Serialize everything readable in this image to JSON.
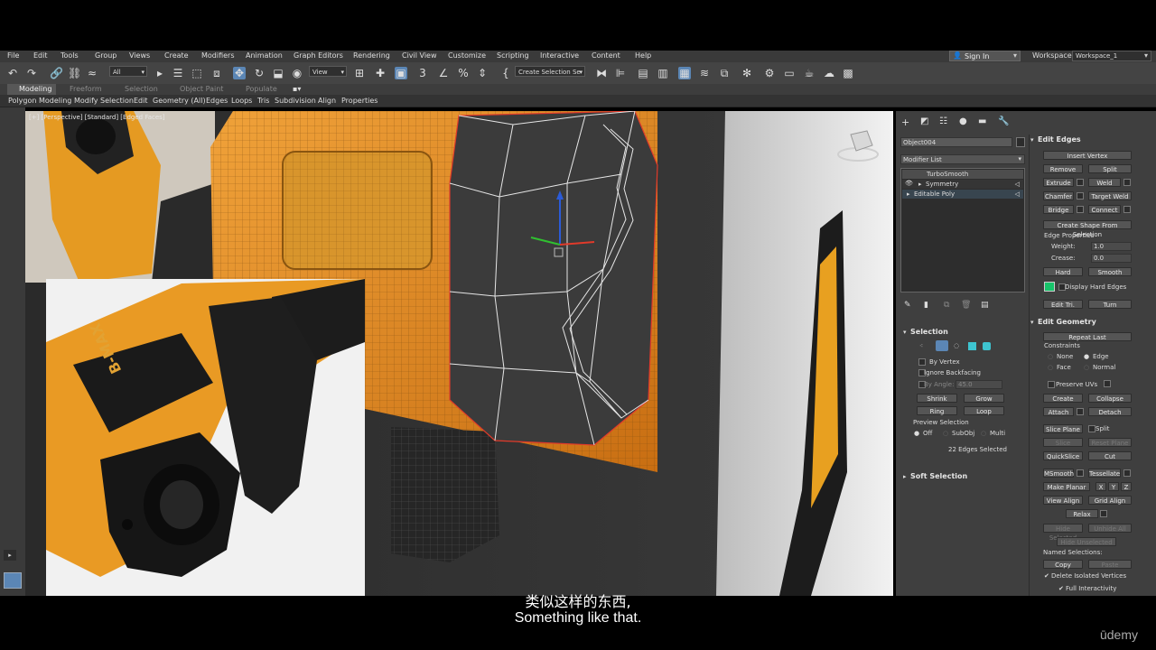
{
  "menu": [
    "File",
    "Edit",
    "Tools",
    "Group",
    "Views",
    "Create",
    "Modifiers",
    "Animation",
    "Graph Editors",
    "Rendering",
    "Civil View",
    "Customize",
    "Scripting",
    "Interactive",
    "Content",
    "Help"
  ],
  "account": {
    "sign_in": "Sign In",
    "workspaces_label": "Workspaces:",
    "workspace_value": "Workspace_1"
  },
  "toolbar": {
    "filter_value": "All",
    "view_value": "View",
    "create_selection_set": "Create Selection Se"
  },
  "ribbon_tabs": [
    "Modeling",
    "Freeform",
    "Selection",
    "Object Paint",
    "Populate"
  ],
  "subribbon": [
    "Polygon Modeling",
    "Modify Selection",
    "Edit",
    "Geometry (All)",
    "Edges",
    "Loops",
    "Tris",
    "Subdivision",
    "Align",
    "Properties"
  ],
  "viewport": {
    "label": "[+] [Perspective] [Standard] [Edged Faces]",
    "product_brand": "B-MAX"
  },
  "command_panel": {
    "object_name": "Object004",
    "modifier_list": "Modifier List",
    "stack": [
      "TurboSmooth",
      "Symmetry",
      "Editable Poly"
    ],
    "selection": {
      "title": "Selection",
      "by_vertex": "By Vertex",
      "ignore_backfacing": "Ignore Backfacing",
      "by_angle": "By Angle:",
      "angle_value": "45.0",
      "shrink": "Shrink",
      "grow": "Grow",
      "ring": "Ring",
      "loop": "Loop",
      "preview_selection": "Preview Selection",
      "off": "Off",
      "subobj": "SubObj",
      "multi": "Multi",
      "status": "22 Edges Selected"
    },
    "soft_selection": "Soft Selection",
    "edit_edges": {
      "title": "Edit Edges",
      "insert_vertex": "Insert Vertex",
      "remove": "Remove",
      "split": "Split",
      "extrude": "Extrude",
      "weld": "Weld",
      "chamfer": "Chamfer",
      "target_weld": "Target Weld",
      "bridge": "Bridge",
      "connect": "Connect",
      "create_shape": "Create Shape From Selection",
      "edge_properties": "Edge Properties",
      "weight_label": "Weight:",
      "weight_value": "1.0",
      "crease_label": "Crease:",
      "crease_value": "0.0",
      "hard": "Hard",
      "smooth": "Smooth",
      "display_hard_edges": "Display Hard Edges",
      "edit_tri": "Edit Tri.",
      "turn": "Turn"
    },
    "edit_geometry": {
      "title": "Edit Geometry",
      "repeat_last": "Repeat Last",
      "constraints": "Constraints",
      "none": "None",
      "edge": "Edge",
      "face": "Face",
      "normal": "Normal",
      "preserve_uvs": "Preserve UVs",
      "create": "Create",
      "collapse": "Collapse",
      "attach": "Attach",
      "detach": "Detach",
      "slice_plane": "Slice Plane",
      "split": "Split",
      "slice": "Slice",
      "reset_plane": "Reset Plane",
      "quickslice": "QuickSlice",
      "cut": "Cut",
      "msmooth": "MSmooth",
      "tessellate": "Tessellate",
      "make_planar": "Make Planar",
      "x": "X",
      "y": "Y",
      "z": "Z",
      "view_align": "View Align",
      "grid_align": "Grid Align",
      "relax": "Relax",
      "hide_selected": "Hide Selected",
      "unhide_all": "Unhide All",
      "hide_unselected": "Hide Unselected",
      "named_selections": "Named Selections:",
      "copy": "Copy",
      "paste": "Paste",
      "delete_isolated": "Delete Isolated Vertices",
      "full_interactivity": "Full Interactivity"
    }
  },
  "subtitles": {
    "cn": "类似这样的东西,",
    "en": "Something like that."
  },
  "watermark": "ūdemy",
  "colors": {
    "accent_blue": "#5b86b5",
    "model_orange": "#e8891d",
    "selected_edge": "#e03a2a",
    "hard_edges_swatch": "#17c46a"
  }
}
